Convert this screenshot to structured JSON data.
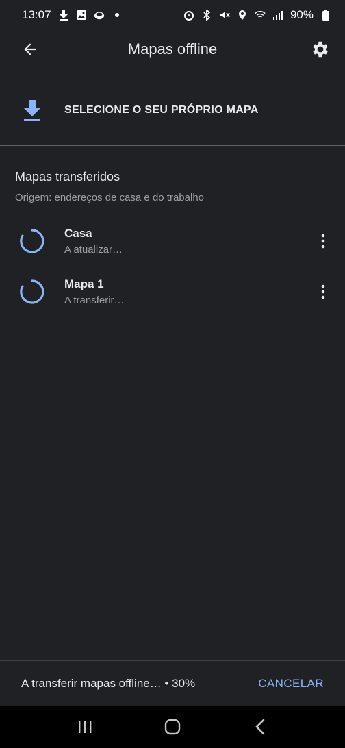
{
  "status_bar": {
    "time": "13:07",
    "battery": "90%",
    "left_icons": [
      "download-icon",
      "image-icon",
      "cloud-app-icon",
      "dot-icon"
    ],
    "right_icons": [
      "alarm-icon",
      "bluetooth-icon",
      "mute-icon",
      "location-icon",
      "wifi-icon",
      "signal-icon",
      "battery-icon"
    ]
  },
  "app_bar": {
    "title": "Mapas offline",
    "back_icon": "arrow-back-icon",
    "settings_icon": "gear-icon"
  },
  "select_map": {
    "label": "SELECIONE O SEU PRÓPRIO MAPA",
    "icon": "download-icon",
    "accent": "#8ab4f8"
  },
  "downloaded": {
    "title": "Mapas transferidos",
    "subtitle": "Origem: endereços de casa e do trabalho",
    "items": [
      {
        "name": "Casa",
        "status": "A atualizar…"
      },
      {
        "name": "Mapa 1",
        "status": "A transferir…"
      }
    ]
  },
  "bottom": {
    "progress": "A transferir mapas offline… • 30%",
    "cancel": "CANCELAR"
  },
  "nav": {
    "recents_icon": "recents-icon",
    "home_icon": "home-icon",
    "back_icon": "nav-back-icon"
  },
  "colors": {
    "background": "#202124",
    "text": "#e8eaed",
    "secondary_text": "#9aa0a6",
    "accent": "#8ab4f8"
  }
}
